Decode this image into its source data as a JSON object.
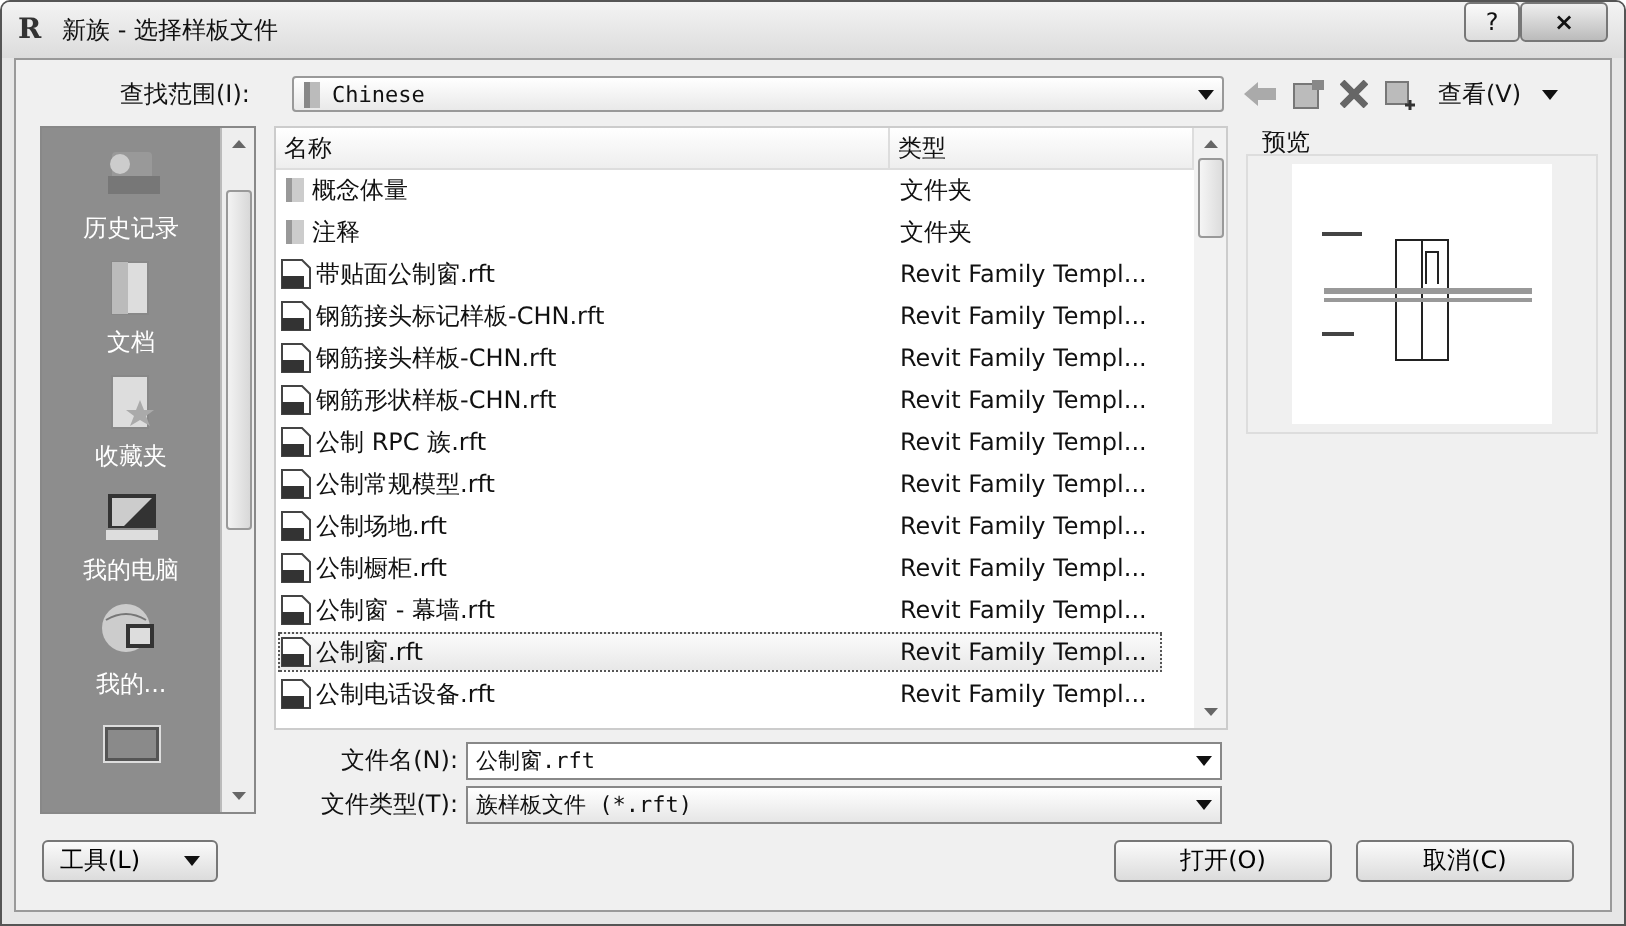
{
  "window": {
    "app_icon": "R",
    "title": "新族 - 选择样板文件",
    "help": "?",
    "close": "×"
  },
  "look_in": {
    "label": "查找范围(I):",
    "value": "Chinese",
    "view_menu": "查看(V)"
  },
  "places": [
    {
      "label": "历史记录",
      "kind": "history"
    },
    {
      "label": "文档",
      "kind": "documents"
    },
    {
      "label": "收藏夹",
      "kind": "favorites"
    },
    {
      "label": "我的电脑",
      "kind": "computer"
    },
    {
      "label": "我的...",
      "kind": "network"
    },
    {
      "kind": "desktop"
    }
  ],
  "file_list": {
    "columns": [
      "名称",
      "类型"
    ],
    "rows": [
      {
        "name": "概念体量",
        "type": "文件夹",
        "kind": "folder",
        "selected": false
      },
      {
        "name": "注释",
        "type": "文件夹",
        "kind": "folder",
        "selected": false
      },
      {
        "name": "带贴面公制窗.rft",
        "type": "Revit Family Templ...",
        "kind": "file",
        "selected": false
      },
      {
        "name": "钢筋接头标记样板-CHN.rft",
        "type": "Revit Family Templ...",
        "kind": "file",
        "selected": false
      },
      {
        "name": "钢筋接头样板-CHN.rft",
        "type": "Revit Family Templ...",
        "kind": "file",
        "selected": false
      },
      {
        "name": "钢筋形状样板-CHN.rft",
        "type": "Revit Family Templ...",
        "kind": "file",
        "selected": false
      },
      {
        "name": "公制 RPC 族.rft",
        "type": "Revit Family Templ...",
        "kind": "file",
        "selected": false
      },
      {
        "name": "公制常规模型.rft",
        "type": "Revit Family Templ...",
        "kind": "file",
        "selected": false
      },
      {
        "name": "公制场地.rft",
        "type": "Revit Family Templ...",
        "kind": "file",
        "selected": false
      },
      {
        "name": "公制橱柜.rft",
        "type": "Revit Family Templ...",
        "kind": "file",
        "selected": false
      },
      {
        "name": "公制窗 - 幕墙.rft",
        "type": "Revit Family Templ...",
        "kind": "file",
        "selected": false
      },
      {
        "name": "公制窗.rft",
        "type": "Revit Family Templ...",
        "kind": "file",
        "selected": true
      },
      {
        "name": "公制电话设备.rft",
        "type": "Revit Family Templ...",
        "kind": "file",
        "selected": false
      }
    ]
  },
  "preview": {
    "label": "预览"
  },
  "file_name": {
    "label": "文件名(N):",
    "value": "公制窗.rft"
  },
  "file_type": {
    "label": "文件类型(T):",
    "value": "族样板文件 (*.rft)"
  },
  "buttons": {
    "tools": "工具(L)",
    "open": "打开(O)",
    "cancel": "取消(C)"
  }
}
